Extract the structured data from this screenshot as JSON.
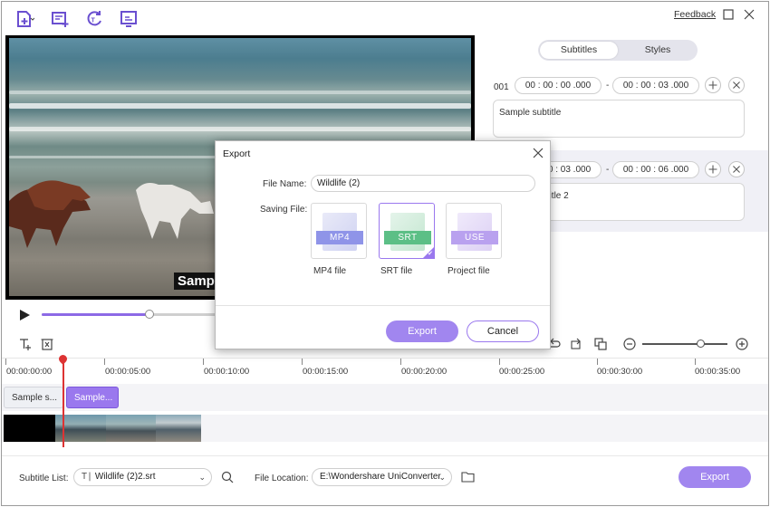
{
  "toolbar": {
    "icons": [
      "add-file-icon",
      "add-subtitle-icon",
      "auto-subtitle-icon",
      "subtitle-screen-icon"
    ],
    "feedback_label": "Feedback"
  },
  "video": {
    "overlay_text": "Samp"
  },
  "player": {
    "progress": 0.27
  },
  "panel": {
    "tabs": [
      "Subtitles",
      "Styles"
    ],
    "active_tab": "Subtitles",
    "entries": [
      {
        "index": "001",
        "start": "00 : 00 : 00 .000",
        "end": "00 : 00 : 03 .000",
        "text": "Sample subtitle"
      },
      {
        "index": "",
        "start": "00 : 00 : 03 .000",
        "end": "00 : 00 : 06 .000",
        "text": "Sample subtitle 2"
      }
    ],
    "separator": "-"
  },
  "timeline": {
    "ruler": [
      "00:00:00:00",
      "00:00:05:00",
      "00:00:10:00",
      "00:00:15:00",
      "00:00:20:00",
      "00:00:25:00",
      "00:00:30:00",
      "00:00:35:00"
    ],
    "clips": [
      "Sample s...",
      "Sample..."
    ]
  },
  "bottom": {
    "subtitle_list_label": "Subtitle List:",
    "subtitle_file": "Wildlife  (2)2.srt",
    "file_location_label": "File Location:",
    "file_location": "E:\\Wondershare UniConverter",
    "export_label": "Export"
  },
  "modal": {
    "title": "Export",
    "file_name_label": "File Name:",
    "file_name_value": "Wildlife  (2)",
    "saving_file_label": "Saving File:",
    "formats": [
      {
        "band": "MP4",
        "caption": "MP4 file",
        "color": "#8f94e8",
        "selected": false
      },
      {
        "band": "SRT",
        "caption": "SRT file",
        "color": "#5cbf86",
        "selected": true
      },
      {
        "band": "USE",
        "caption": "Project file",
        "color": "#b9a1ef",
        "selected": false
      }
    ],
    "export_button": "Export",
    "cancel_button": "Cancel"
  },
  "colors": {
    "accent": "#9a78ee",
    "accent_button": "#a186ef",
    "playhead": "#dd3333"
  }
}
